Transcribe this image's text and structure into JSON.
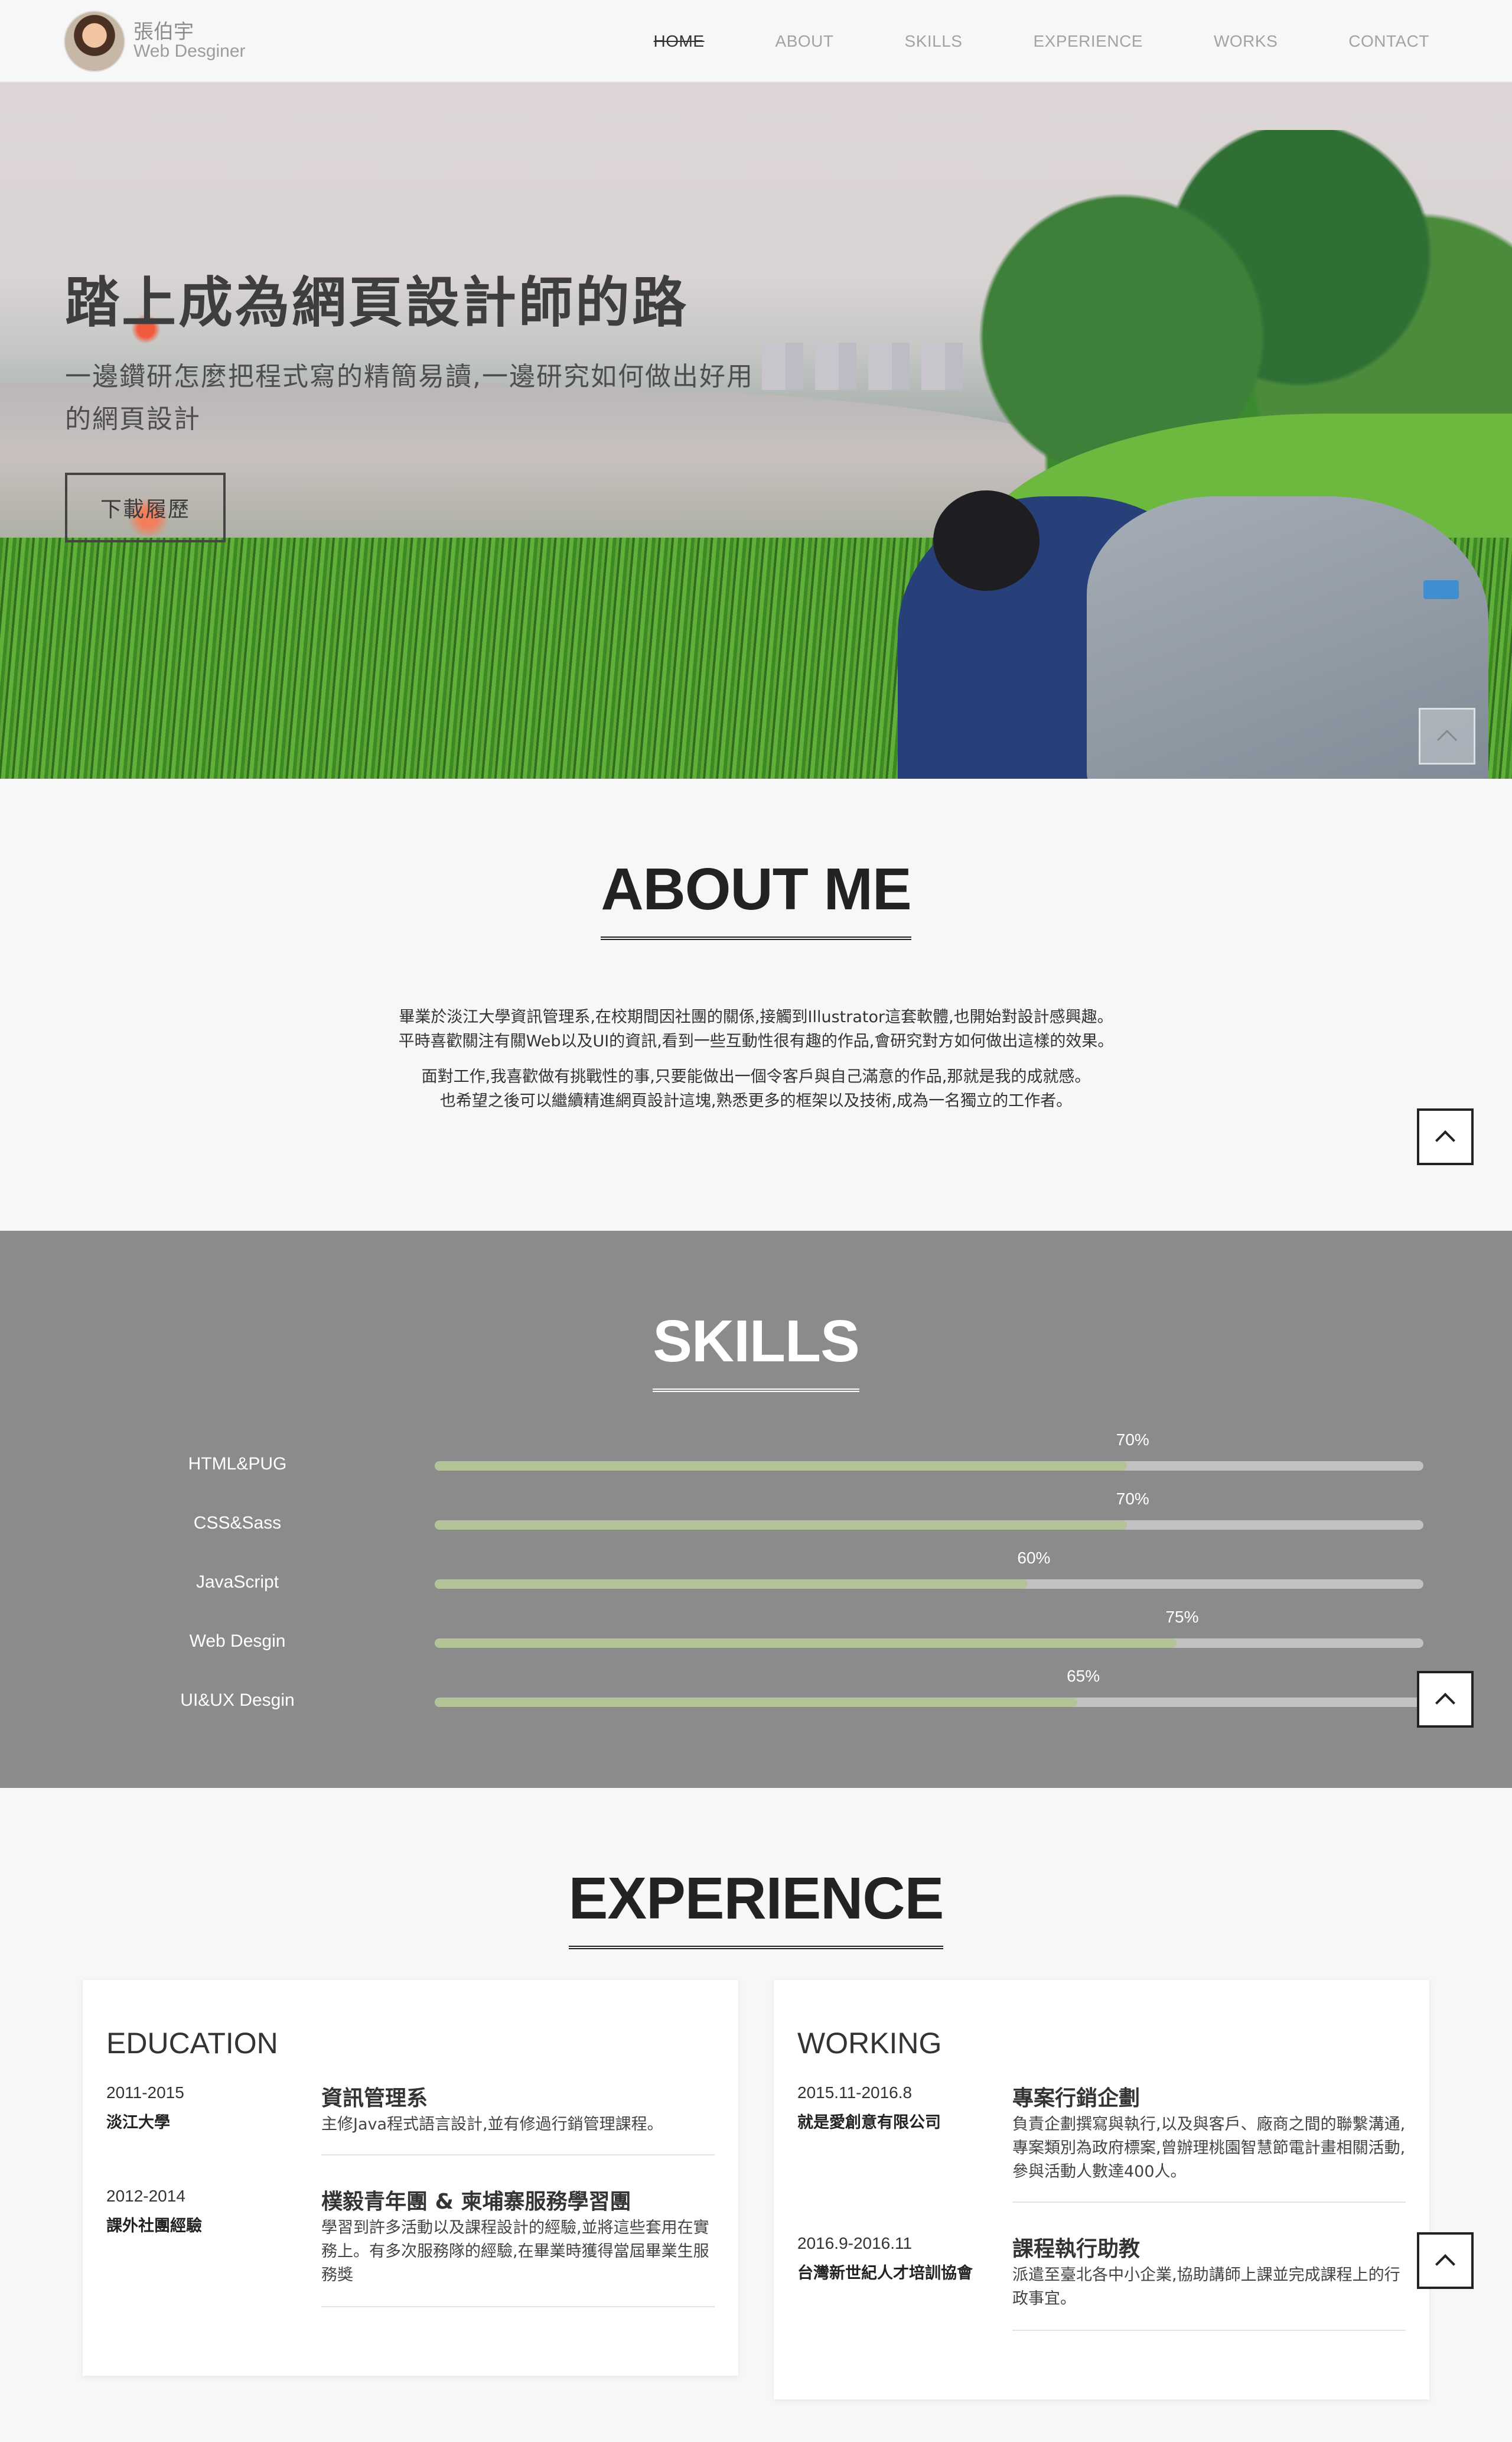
{
  "header": {
    "name": "張伯宇",
    "role": "Web Desginer",
    "nav": [
      "HOME",
      "ABOUT",
      "SKILLS",
      "EXPERIENCE",
      "WORKS",
      "CONTACT"
    ]
  },
  "hero": {
    "title": "踏上成為網頁設計師的路",
    "subtitle": "一邊鑽研怎麼把程式寫的精簡易讀,一邊研究如何做出好用的網頁設計",
    "button": "下載履歷"
  },
  "about": {
    "title": "ABOUT ME",
    "paragraphs": [
      "畢業於淡江大學資訊管理系,在校期間因社團的關係,接觸到Illustrator這套軟體,也開始對設計感興趣。",
      "平時喜歡關注有關Web以及UI的資訊,看到一些互動性很有趣的作品,會研究對方如何做出這樣的效果。",
      "面對工作,我喜歡做有挑戰性的事,只要能做出一個令客戶與自己滿意的作品,那就是我的成就感。",
      "也希望之後可以繼續精進網頁設計這塊,熟悉更多的框架以及技術,成為一名獨立的工作者。"
    ]
  },
  "skills": {
    "title": "SKILLS",
    "items": [
      {
        "name": "HTML&PUG",
        "percent": 70,
        "label": "70%"
      },
      {
        "name": "CSS&Sass",
        "percent": 70,
        "label": "70%"
      },
      {
        "name": "JavaScript",
        "percent": 60,
        "label": "60%"
      },
      {
        "name": "Web Desgin",
        "percent": 75,
        "label": "75%"
      },
      {
        "name": "UI&UX Desgin",
        "percent": 65,
        "label": "65%"
      }
    ]
  },
  "experience": {
    "title": "EXPERIENCE",
    "education": {
      "title": "EDUCATION",
      "entries": [
        {
          "date": "2011-2015",
          "org": "淡江大學",
          "head": "資訊管理系",
          "desc": "主修Java程式語言設計,並有修過行銷管理課程。"
        },
        {
          "date": "2012-2014",
          "org": "課外社團經驗",
          "head": "樸毅青年團 & 柬埔寨服務學習團",
          "desc": "學習到許多活動以及課程設計的經驗,並將這些套用在實務上。有多次服務隊的經驗,在畢業時獲得當屆畢業生服務獎"
        }
      ]
    },
    "working": {
      "title": "WORKING",
      "entries": [
        {
          "date": "2015.11-2016.8",
          "org": "就是愛創意有限公司",
          "head": "專案行銷企劃",
          "desc": "負責企劃撰寫與執行,以及與客戶、廠商之間的聯繫溝通,專案類別為政府標案,曾辦理桃園智慧節電計畫相關活動,參與活動人數達400人。"
        },
        {
          "date": "2016.9-2016.11",
          "org": "台灣新世紀人才培訓協會",
          "head": "課程執行助教",
          "desc": "派遣至臺北各中小企業,協助講師上課並完成課程上的行政事宜。"
        }
      ]
    }
  },
  "icons": {
    "back_to_top": "chevron-up-icon"
  }
}
